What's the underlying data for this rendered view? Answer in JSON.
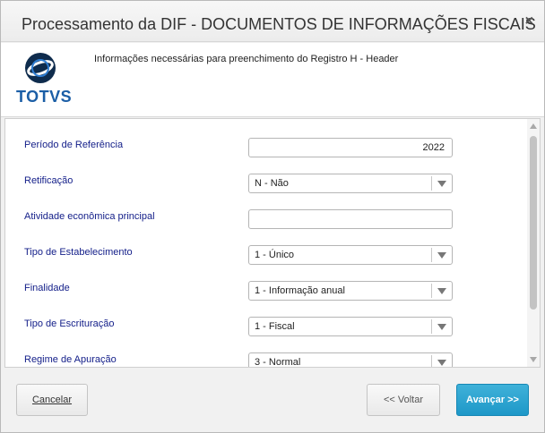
{
  "window": {
    "title": "Processamento da DIF - DOCUMENTOS DE INFORMAÇÕES FISCAIS",
    "close_glyph": "×"
  },
  "header": {
    "logo_text": "TOTVS",
    "description": "Informações necessárias para preenchimento do Registro H - Header",
    "colors": {
      "logo_blue": "#1b5ea6",
      "logo_dark": "#0f2c4d"
    }
  },
  "form": {
    "fields": [
      {
        "label": "Período de Referência",
        "type": "text",
        "value": "2022"
      },
      {
        "label": "Retificação",
        "type": "select",
        "value": "N - Não"
      },
      {
        "label": "Atividade econômica principal",
        "type": "text",
        "value": ""
      },
      {
        "label": "Tipo de Estabelecimento",
        "type": "select",
        "value": "1 - Único"
      },
      {
        "label": "Finalidade",
        "type": "select",
        "value": "1 - Informação anual"
      },
      {
        "label": "Tipo de Escrituração",
        "type": "select",
        "value": "1 - Fiscal"
      },
      {
        "label": "Regime de Apuração",
        "type": "select",
        "value": "3 - Normal"
      }
    ],
    "label_color": "#15208a"
  },
  "footer": {
    "cancel_label": "Cancelar",
    "back_label": "<< Voltar",
    "next_label": "Avançar >>",
    "accent": "#1e98c8"
  }
}
